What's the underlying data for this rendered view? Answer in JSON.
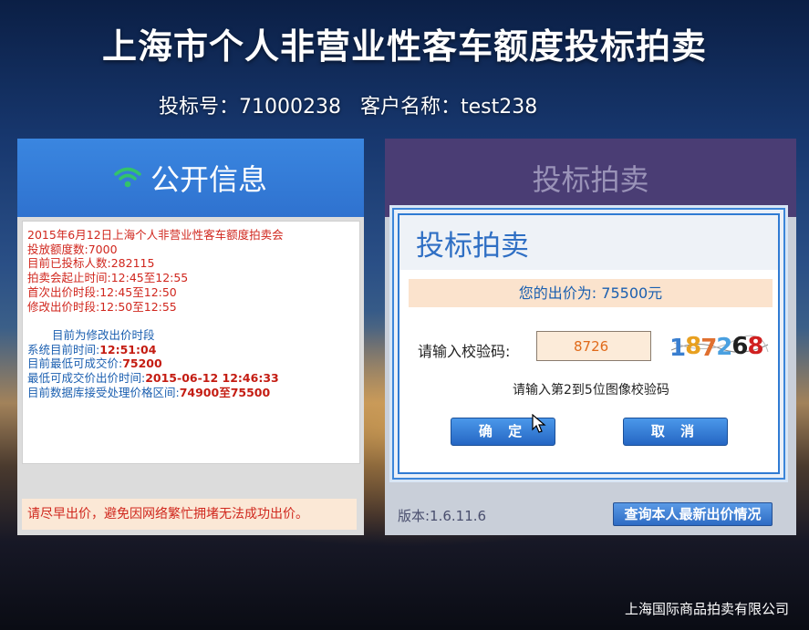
{
  "page": {
    "title": "上海市个人非营业性客车额度投标拍卖",
    "bidder_line": "投标号：71000238   客户名称：test238"
  },
  "left_panel": {
    "header": "公开信息",
    "header_icon": "wifi-icon",
    "info_red": [
      "2015年6月12日上海个人非营业性客车额度拍卖会",
      "投放额度数:7000",
      "目前已投标人数:282115",
      "拍卖会起止时间:12:45至12:55",
      "首次出价时段:12:45至12:50",
      "修改出价时段:12:50至12:55"
    ],
    "current_phase": "目前为修改出价时段",
    "system_time_label": "系统目前时间:",
    "system_time_value": "12:51:04",
    "min_price_label": "目前最低可成交价:",
    "min_price_value": "75200",
    "min_price_time_label": "最低可成交价出价时间:",
    "min_price_time_value": "2015-06-12 12:46:33",
    "accept_range_label": "目前数据库接受处理价格区间:",
    "accept_range_value": "74900至75500",
    "warning": "请尽早出价，避免因网络繁忙拥堵无法成功出价。"
  },
  "right_panel": {
    "header": "投标拍卖",
    "dialog": {
      "title": "投标拍卖",
      "price_line": "您的出价为: 75500元",
      "captcha_label": "请输入校验码:",
      "captcha_value": "8726",
      "captcha_digits": [
        "1",
        "8",
        "7",
        "2",
        "6",
        "8"
      ],
      "captcha_colors": [
        "#3a7fd0",
        "#e8a020",
        "#e07030",
        "#4aa0e0",
        "#202020",
        "#d02020"
      ],
      "captcha_hint": "请输入第2到5位图像校验码",
      "confirm_label": "确 定",
      "cancel_label": "取 消"
    },
    "version": "版本:1.6.11.6",
    "query_button": "查询本人最新出价情况"
  },
  "footer": "上海国际商品拍卖有限公司"
}
